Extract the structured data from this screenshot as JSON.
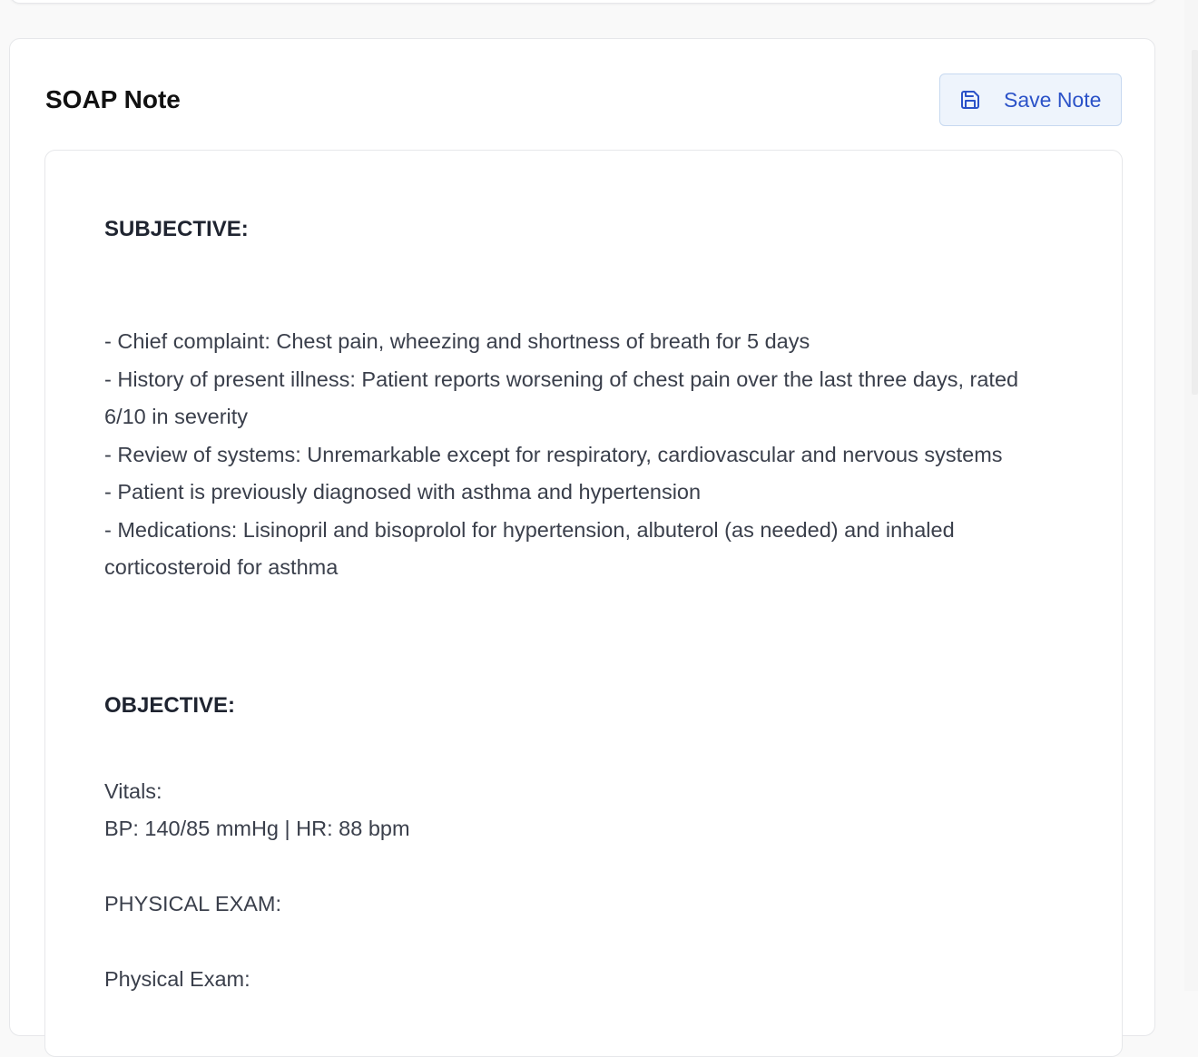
{
  "card": {
    "title": "SOAP Note",
    "save_label": "Save Note"
  },
  "note": {
    "subjective": {
      "heading": "SUBJECTIVE:",
      "items": [
        "- Chief complaint: Chest pain, wheezing and shortness of breath for 5 days",
        "- History of present illness: Patient reports worsening of chest pain over the last three days, rated 6/10 in severity",
        "- Review of systems: Unremarkable except for respiratory, cardiovascular and nervous systems",
        "- Patient is previously diagnosed with asthma and hypertension",
        "- Medications: Lisinopril and bisoprolol for hypertension, albuterol (as needed) and inhaled corticosteroid for asthma"
      ]
    },
    "objective": {
      "heading": "OBJECTIVE:",
      "vitals_label": "Vitals:",
      "vitals_values": "BP: 140/85 mmHg | HR: 88 bpm",
      "physical_exam_heading": "PHYSICAL EXAM:",
      "physical_exam_label": "Physical Exam:"
    }
  },
  "icons": {
    "save": "save-icon"
  },
  "colors": {
    "accent": "#2b52c8",
    "button_bg": "#eef4fc",
    "text": "#3a3f4b"
  }
}
